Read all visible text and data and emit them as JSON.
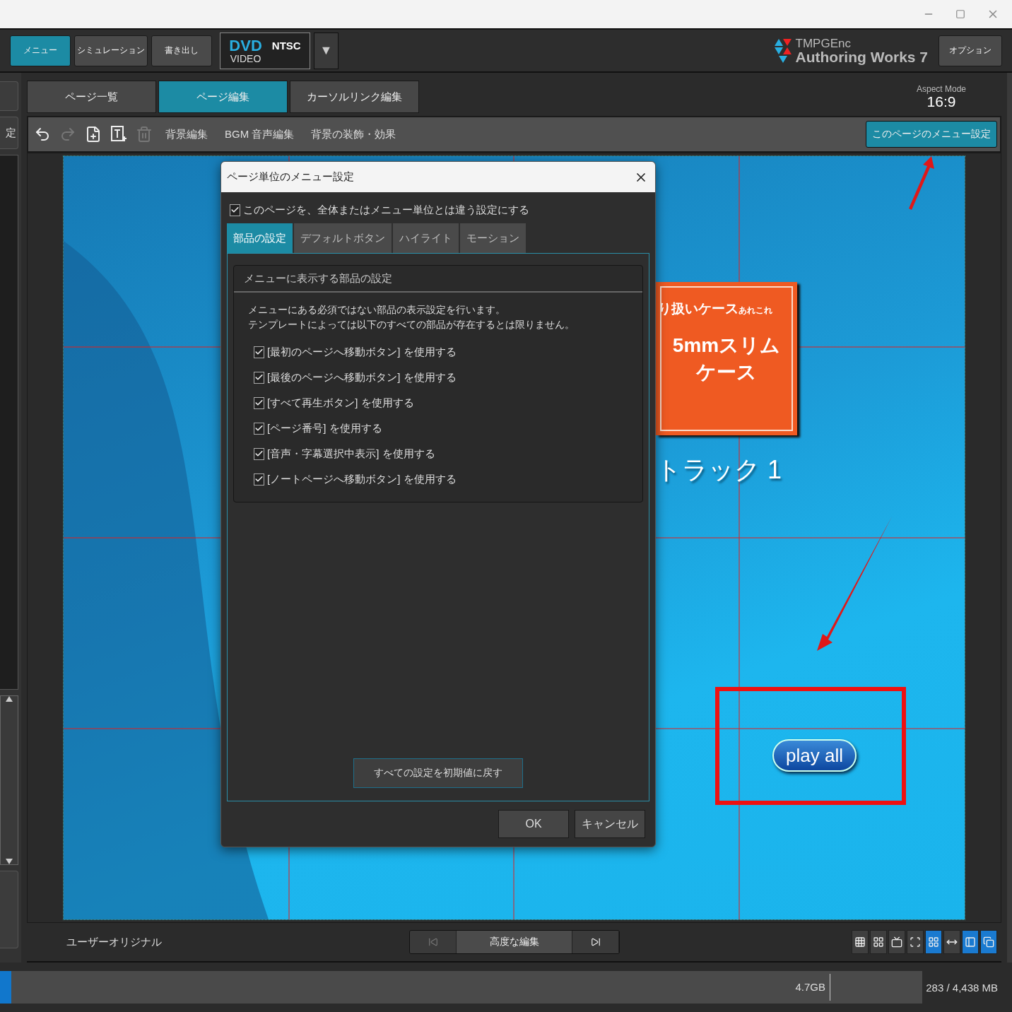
{
  "top_bar": {
    "modes": [
      {
        "label": "メニュー",
        "selected": true
      },
      {
        "label": "シミュレーション",
        "selected": false
      },
      {
        "label": "書き出し",
        "selected": false
      }
    ],
    "disc": {
      "format": "DVD",
      "sub": "VIDEO",
      "standard": "NTSC"
    },
    "dropdown": "▼",
    "logo": {
      "line1": "TMPGEnc",
      "line2": "Authoring Works 7"
    },
    "options_button": "オプション"
  },
  "sidebar": {
    "cut_button": "定"
  },
  "page_tabs": [
    {
      "label": "ページ一覧",
      "selected": false
    },
    {
      "label": "ページ編集",
      "selected": true
    },
    {
      "label": "カーソルリンク編集",
      "selected": false
    }
  ],
  "aspect": {
    "label": "Aspect Mode",
    "value": "16:9"
  },
  "toolbar": {
    "icons": [
      {
        "kind": "undo",
        "disabled": false
      },
      {
        "kind": "redo",
        "disabled": true
      },
      {
        "kind": "add-page",
        "disabled": false
      },
      {
        "kind": "add-text",
        "disabled": false
      },
      {
        "kind": "delete",
        "disabled": true
      }
    ],
    "text_buttons": [
      "背景編集",
      "BGM 音声編集",
      "背景の装飾・効果"
    ],
    "page_menu_button": "このページのメニュー設定"
  },
  "canvas": {
    "card": {
      "title": "り扱いケース",
      "title_small": "あれこれ",
      "line1": "5mmスリム",
      "line2": "ケース"
    },
    "track": "トラック 1",
    "play_button": "play all"
  },
  "dialog": {
    "title": "ページ単位のメニュー設定",
    "override": {
      "label": "このページを、全体またはメニュー単位とは違う設定にする",
      "checked": true
    },
    "tabs": [
      {
        "label": "部品の設定",
        "selected": true
      },
      {
        "label": "デフォルトボタン",
        "selected": false
      },
      {
        "label": "ハイライト",
        "selected": false
      },
      {
        "label": "モーション",
        "selected": false
      }
    ],
    "group_title": "メニューに表示する部品の設定",
    "description": [
      "メニューにある必須ではない部品の表示設定を行います。",
      "テンプレートによっては以下のすべての部品が存在するとは限りません。"
    ],
    "options": [
      {
        "label": "[最初のページへ移動ボタン] を使用する",
        "checked": true
      },
      {
        "label": "[最後のページへ移動ボタン] を使用する",
        "checked": true
      },
      {
        "label": "[すべて再生ボタン] を使用する",
        "checked": true
      },
      {
        "label": "[ページ番号] を使用する",
        "checked": true
      },
      {
        "label": "[音声・字幕選択中表示] を使用する",
        "checked": true
      },
      {
        "label": "[ノートページへ移動ボタン] を使用する",
        "checked": true
      }
    ],
    "reset_button": "すべての設定を初期値に戻す",
    "buttons": [
      "OK",
      "キャンセル"
    ]
  },
  "bottom_bar": {
    "template": "ユーザーオリジナル",
    "advanced_button": "高度な編集",
    "view_icons": [
      {
        "kind": "grid",
        "selected": false
      },
      {
        "kind": "layout",
        "selected": false
      },
      {
        "kind": "tv-safe",
        "selected": false
      },
      {
        "kind": "frame",
        "selected": false
      },
      {
        "kind": "guides",
        "selected": true
      },
      {
        "kind": "stretch",
        "selected": false
      },
      {
        "kind": "align",
        "selected": true
      },
      {
        "kind": "copy",
        "selected": true
      }
    ]
  },
  "status_bar": {
    "disc_usage": {
      "level": 0.012
    },
    "capacity": "4.7GB",
    "size": "283 / 4,438 MB"
  }
}
